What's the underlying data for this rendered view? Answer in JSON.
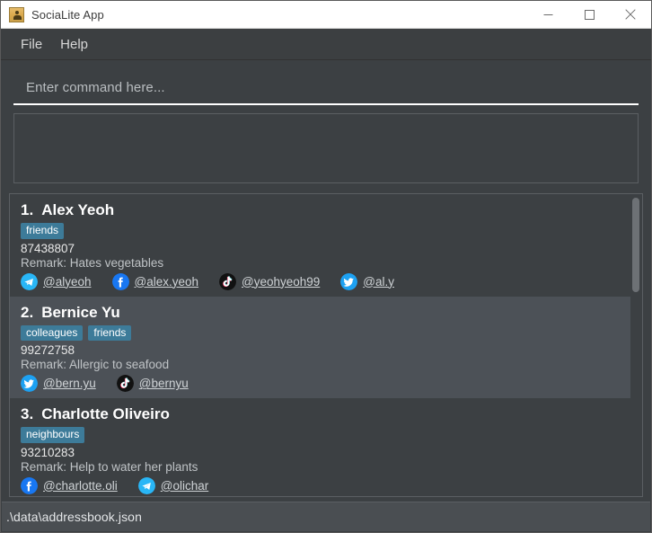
{
  "window": {
    "title": "SociaLite App",
    "icon": "app-person-icon",
    "controls": {
      "minimize": "minimize-icon",
      "maximize": "maximize-icon",
      "close": "close-icon"
    }
  },
  "menubar": {
    "items": [
      {
        "label": "File"
      },
      {
        "label": "Help"
      }
    ]
  },
  "command": {
    "placeholder": "Enter command here...",
    "value": ""
  },
  "result": {
    "text": ""
  },
  "colors": {
    "window_bg": "#3c4043",
    "card_alt_bg": "#4c5157",
    "tag_bg": "#3d7b99",
    "accent_underline": "#ffffff",
    "status_bg": "#4a4e52",
    "titlebar_bg": "#ffffff"
  },
  "persons": [
    {
      "index": "1.",
      "name": "Alex Yeoh",
      "tags": [
        "friends"
      ],
      "phone": "87438807",
      "remark": "Remark: Hates vegetables",
      "selected": false,
      "socials": [
        {
          "platform": "telegram-icon",
          "handle": "@alyeoh"
        },
        {
          "platform": "facebook-icon",
          "handle": "@alex.yeoh"
        },
        {
          "platform": "tiktok-icon",
          "handle": "@yeohyeoh99"
        },
        {
          "platform": "twitter-icon",
          "handle": "@al.y"
        }
      ]
    },
    {
      "index": "2.",
      "name": "Bernice Yu",
      "tags": [
        "colleagues",
        "friends"
      ],
      "phone": "99272758",
      "remark": "Remark: Allergic to seafood",
      "selected": true,
      "socials": [
        {
          "platform": "twitter-icon",
          "handle": "@bern.yu"
        },
        {
          "platform": "tiktok-icon",
          "handle": "@bernyu"
        }
      ]
    },
    {
      "index": "3.",
      "name": "Charlotte Oliveiro",
      "tags": [
        "neighbours"
      ],
      "phone": "93210283",
      "remark": "Remark: Help to water her plants",
      "selected": false,
      "socials": [
        {
          "platform": "facebook-icon",
          "handle": "@charlotte.oli"
        },
        {
          "platform": "telegram-icon",
          "handle": "@olichar"
        }
      ]
    }
  ],
  "statusbar": {
    "path": ".\\data\\addressbook.json"
  },
  "scrollbar": {
    "thumb_position": "top"
  }
}
